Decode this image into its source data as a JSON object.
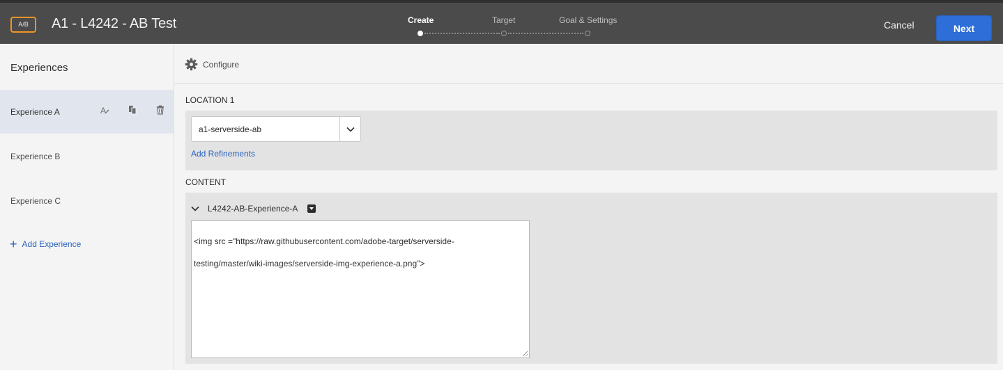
{
  "header": {
    "badge": "A/B",
    "title": "A1 - L4242 - AB Test",
    "steps": [
      {
        "label": "Create",
        "active": true
      },
      {
        "label": "Target",
        "active": false
      },
      {
        "label": "Goal & Settings",
        "active": false
      }
    ],
    "cancel_label": "Cancel",
    "next_label": "Next"
  },
  "sidebar": {
    "title": "Experiences",
    "items": [
      {
        "label": "Experience A",
        "selected": true
      },
      {
        "label": "Experience B",
        "selected": false
      },
      {
        "label": "Experience C",
        "selected": false
      }
    ],
    "add_label": "Add Experience"
  },
  "main": {
    "configure_label": "Configure",
    "location": {
      "section_label": "LOCATION 1",
      "selected_value": "a1-serverside-ab",
      "add_refinements_label": "Add Refinements"
    },
    "content": {
      "section_label": "CONTENT",
      "offer_name": "L4242-AB-Experience-A",
      "code_lines": [
        "<img src =\"https://raw.githubusercontent.com/adobe-target/serverside-",
        "testing/master/wiki-images/serverside-img-experience-a.png\">"
      ]
    }
  },
  "colors": {
    "header_bg": "#4b4b4b",
    "accent": "#2d6ed8",
    "badge_border": "#f29423",
    "selected_row": "#e1e6ee"
  }
}
